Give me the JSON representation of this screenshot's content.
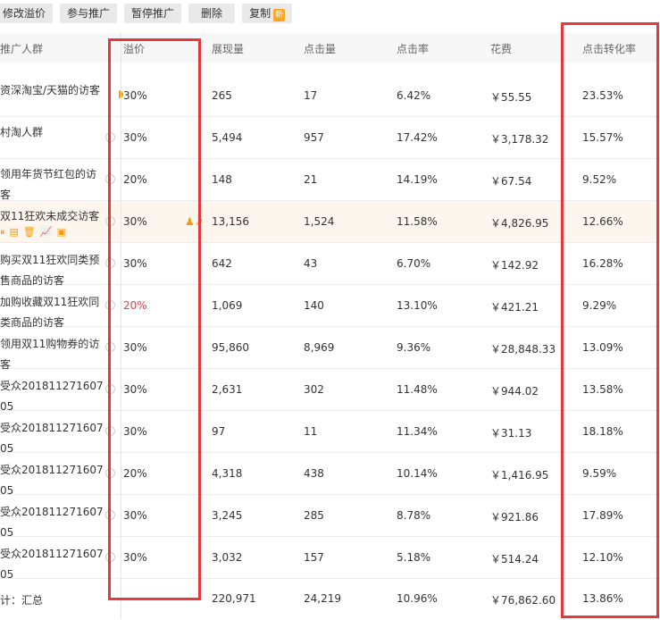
{
  "toolbar": {
    "edit_premium": "修改溢价",
    "join": "参与推广",
    "pause": "暂停推广",
    "delete": "删除",
    "copy": "复制",
    "new_badge": "新"
  },
  "columns": {
    "name": "推广人群",
    "premium": "溢价",
    "impressions": "展现量",
    "clicks": "点击量",
    "ctr": "点击率",
    "cost": "花费",
    "cvr": "点击转化率"
  },
  "rows": [
    {
      "name": "资深淘宝/天猫的访客",
      "premium": "30%",
      "impressions": "265",
      "clicks": "17",
      "ctr": "6.42%",
      "cost": "￥55.55",
      "cvr": "23.53%"
    },
    {
      "name": "村淘人群",
      "premium": "30%",
      "impressions": "5,494",
      "clicks": "957",
      "ctr": "17.42%",
      "cost": "￥3,178.32",
      "cvr": "15.57%"
    },
    {
      "name": "领用年货节红包的访客",
      "premium": "20%",
      "impressions": "148",
      "clicks": "21",
      "ctr": "14.19%",
      "cost": "￥67.54",
      "cvr": "9.52%"
    },
    {
      "name": "双11狂欢未成交访客",
      "premium": "30%",
      "impressions": "13,156",
      "clicks": "1,524",
      "ctr": "11.58%",
      "cost": "￥4,826.95",
      "cvr": "12.66%"
    },
    {
      "name": "购买双11狂欢同类预售商品的访客",
      "premium": "30%",
      "impressions": "642",
      "clicks": "43",
      "ctr": "6.70%",
      "cost": "￥142.92",
      "cvr": "16.28%"
    },
    {
      "name": "加购收藏双11狂欢同类商品的访客",
      "premium": "20%",
      "impressions": "1,069",
      "clicks": "140",
      "ctr": "13.10%",
      "cost": "￥421.21",
      "cvr": "9.29%"
    },
    {
      "name": "领用双11购物券的访客",
      "premium": "30%",
      "impressions": "95,860",
      "clicks": "8,969",
      "ctr": "9.36%",
      "cost": "￥28,848.33",
      "cvr": "13.09%"
    },
    {
      "name": "受众20181127160705",
      "premium": "30%",
      "impressions": "2,631",
      "clicks": "302",
      "ctr": "11.48%",
      "cost": "￥944.02",
      "cvr": "13.58%"
    },
    {
      "name": "受众20181127160705",
      "premium": "30%",
      "impressions": "97",
      "clicks": "11",
      "ctr": "11.34%",
      "cost": "￥31.13",
      "cvr": "18.18%"
    },
    {
      "name": "受众20181127160705",
      "premium": "20%",
      "impressions": "4,318",
      "clicks": "438",
      "ctr": "10.14%",
      "cost": "￥1,416.95",
      "cvr": "9.59%"
    },
    {
      "name": "受众20181127160705",
      "premium": "30%",
      "impressions": "3,245",
      "clicks": "285",
      "ctr": "8.78%",
      "cost": "￥921.86",
      "cvr": "17.89%"
    },
    {
      "name": "受众20181127160705",
      "premium": "30%",
      "impressions": "3,032",
      "clicks": "157",
      "ctr": "5.18%",
      "cost": "￥514.24",
      "cvr": "12.10%"
    }
  ],
  "summary": {
    "label": "计：汇总",
    "impressions": "220,971",
    "clicks": "24,219",
    "ctr": "10.96%",
    "cost": "￥76,862.60",
    "cvr": "13.86%"
  },
  "colors": {
    "accent": "#f39c12",
    "highlight": "#e4393c"
  }
}
